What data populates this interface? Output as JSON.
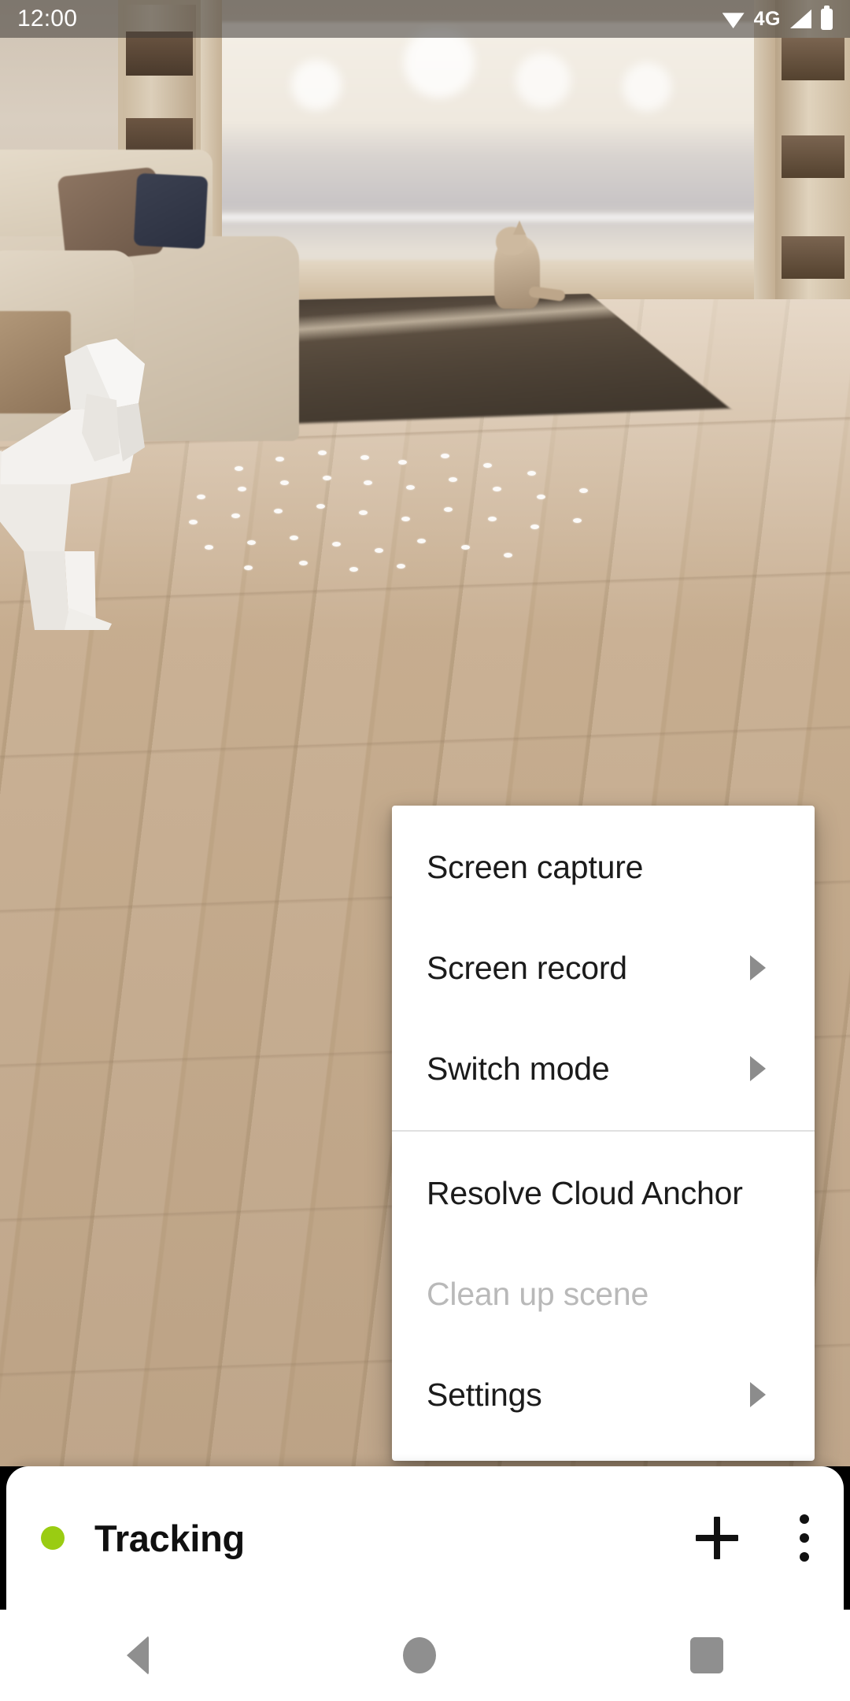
{
  "status_bar": {
    "clock": "12:00",
    "network_label": "4G",
    "icons": [
      "wifi-icon",
      "signal-icon",
      "battery-icon"
    ]
  },
  "ar_scene": {
    "description": "augmented-reality camera view of a living room with a white low-poly dog model placed on the wooden floor",
    "plane_dots_visible": true
  },
  "popup_menu": {
    "groups": [
      {
        "items": [
          {
            "label": "Screen capture",
            "has_submenu": false,
            "disabled": false
          },
          {
            "label": "Screen record",
            "has_submenu": true,
            "disabled": false
          },
          {
            "label": "Switch mode",
            "has_submenu": true,
            "disabled": false
          }
        ]
      },
      {
        "items": [
          {
            "label": "Resolve Cloud Anchor",
            "has_submenu": false,
            "disabled": false
          },
          {
            "label": "Clean up scene",
            "has_submenu": false,
            "disabled": true
          },
          {
            "label": "Settings",
            "has_submenu": true,
            "disabled": false
          }
        ]
      }
    ]
  },
  "bottom_sheet": {
    "status_label": "Tracking",
    "status_color": "#9ACC12",
    "add_icon": "plus-icon",
    "overflow_icon": "more-vertical-icon"
  },
  "nav_bar": {
    "back": "back-icon",
    "home": "home-icon",
    "recents": "recents-icon"
  },
  "colors": {
    "accent_green": "#9ACC12",
    "menu_background": "#ffffff",
    "menu_text": "#1b1b1b",
    "menu_text_disabled": "#b9b9b9",
    "divider": "#e0e0e0",
    "nav_icon": "#8f8f8f"
  }
}
